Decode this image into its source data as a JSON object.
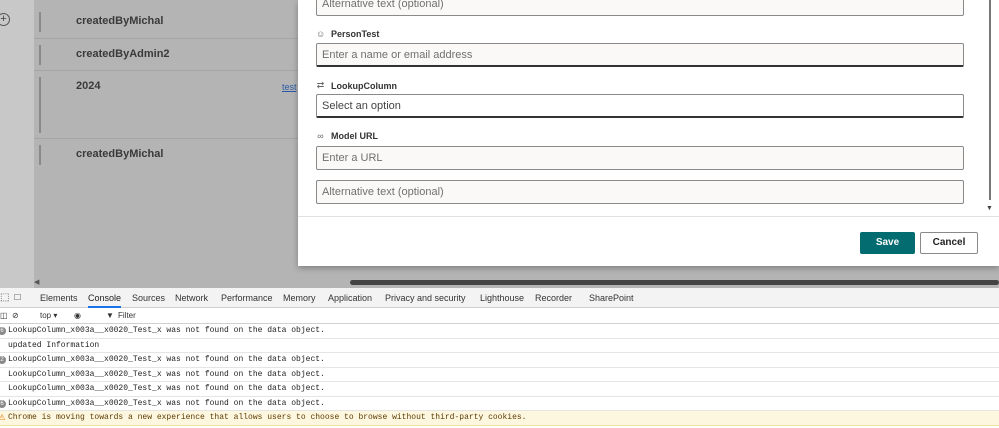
{
  "background_list": {
    "rows": [
      "createdByMichal",
      "createdByAdmin2",
      "2024",
      "createdByMichal"
    ],
    "link": "test",
    "add_icon": "circle-plus-icon"
  },
  "panel": {
    "alt_text_top": "Alternative text (optional)",
    "person": {
      "label": "PersonTest",
      "icon": "person-icon",
      "placeholder": "Enter a name or email address"
    },
    "lookup": {
      "label": "LookupColumn",
      "icon": "swap-arrows-icon",
      "placeholder": "Select an option"
    },
    "model_url": {
      "label": "Model URL",
      "icon": "link-icon",
      "placeholder": "Enter a URL"
    },
    "alt_text_bottom": "Alternative text (optional)",
    "save_label": "Save",
    "cancel_label": "Cancel",
    "accent_color": "#036c70"
  },
  "devtools": {
    "tabs": [
      "Elements",
      "Console",
      "Sources",
      "Network",
      "Performance",
      "Memory",
      "Application",
      "Privacy and security",
      "Lighthouse",
      "Recorder",
      "SharePoint"
    ],
    "active_tab": "Console",
    "context": "top ▾",
    "filter_placeholder": "Filter",
    "logs": [
      {
        "badge": "6",
        "text": "LookupColumn_x003a__x0020_Test_x was not found on the data object."
      },
      {
        "badge": "",
        "text": "updated Information"
      },
      {
        "badge": "2",
        "text": "LookupColumn_x003a__x0020_Test_x was not found on the data object."
      },
      {
        "badge": "",
        "text": "LookupColumn_x003a__x0020_Test_x was not found on the data object."
      },
      {
        "badge": "",
        "text": "LookupColumn_x003a__x0020_Test_x was not found on the data object."
      },
      {
        "badge": "6",
        "text": "LookupColumn_x003a__x0020_Test_x was not found on the data object."
      }
    ],
    "warning": "Chrome is moving towards a new experience that allows users to choose to browse without third-party cookies."
  }
}
